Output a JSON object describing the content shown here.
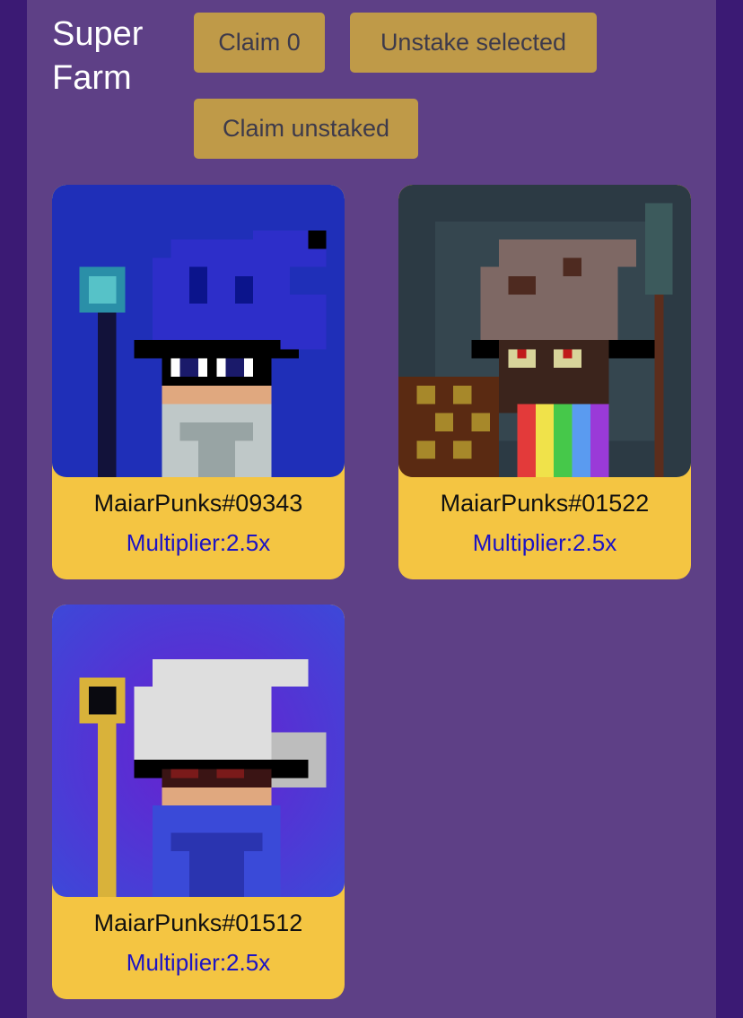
{
  "farm": {
    "title": "Super Farm",
    "buttons": {
      "claim": "Claim 0",
      "unstake_selected": "Unstake selected",
      "claim_unstaked": "Claim unstaked"
    }
  },
  "nfts": [
    {
      "name": "MaiarPunks#09343",
      "multiplier": "Multiplier:2.5x",
      "image": "blue-wizard"
    },
    {
      "name": "MaiarPunks#01522",
      "multiplier": "Multiplier:2.5x",
      "image": "brown-wizard"
    },
    {
      "name": "MaiarPunks#01512",
      "multiplier": "Multiplier:2.5x",
      "image": "white-wizard"
    }
  ],
  "colors": {
    "page_background": "#3b1a74",
    "panel_background": "#5e4086",
    "button_background": "#bf9a48",
    "card_background": "#f4c542",
    "multiplier_text": "#1d14c4"
  }
}
